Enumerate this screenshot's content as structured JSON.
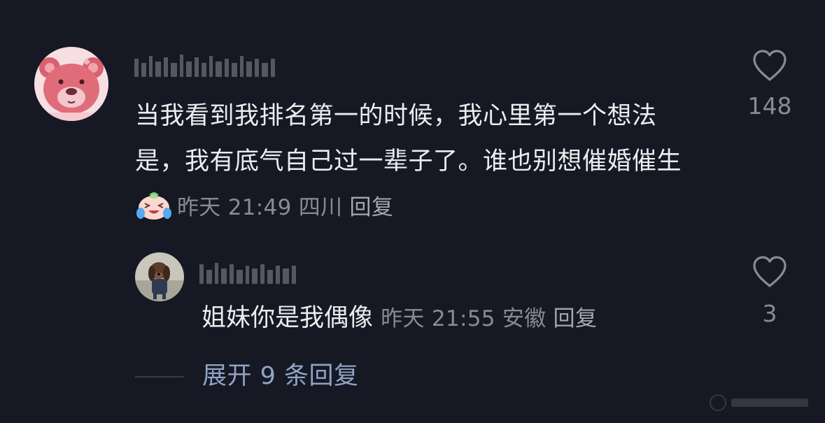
{
  "comment": {
    "username": "",
    "text": "当我看到我排名第一的时候，我心里第一个想法是，我有底气自己过一辈子了。谁也别想催婚催生",
    "emoji_icon": "laughing-crying-emoji-icon",
    "date": "昨天 21:49",
    "location": "四川",
    "reply_label": "回复",
    "like_icon": "heart-outline-icon",
    "like_count": "148"
  },
  "reply": {
    "username": "",
    "text": "姐妹你是我偶像",
    "date": "昨天 21:55",
    "location": "安徽",
    "reply_label": "回复",
    "like_icon": "heart-outline-icon",
    "like_count": "3"
  },
  "expand": {
    "label": "展开 9 条回复"
  },
  "colors": {
    "background": "#161823",
    "primary_text": "#ecedef",
    "secondary_text": "#8a8b91",
    "link": "#8fa3c6"
  }
}
